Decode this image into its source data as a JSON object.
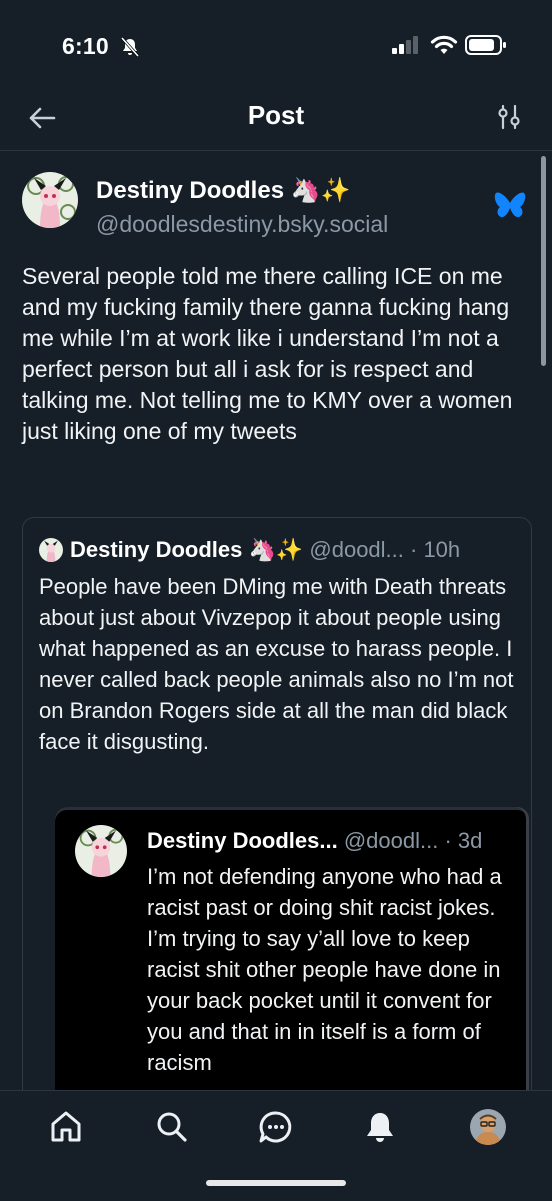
{
  "status_bar": {
    "time": "6:10"
  },
  "nav": {
    "title": "Post"
  },
  "post": {
    "author_name": "Destiny Doodles 🦄✨",
    "handle": "@doodlesdestiny.bsky.social",
    "text": "Several people told me there calling ICE on me and my fucking family there ganna fucking hang me while I’m at work like i understand I’m not a perfect person but all i ask for is respect and talking me. Not telling me to KMY over a women just liking one of my tweets"
  },
  "quote": {
    "author_name": "Destiny Doodles 🦄✨",
    "meta": " @doodl... · 10h",
    "text": "People have been DMing me with Death threats about just about Vivzepop it about people using what happened as an excuse to harass people. I never called back people animals also no I’m not on Brandon Rogers side at all the man did black face it disgusting."
  },
  "nested_quote": {
    "author_name": "Destiny Doodles...",
    "meta": " @doodl... · 3d",
    "text": "I’m not defending anyone who had a racist past or doing shit racist jokes. I’m trying to say y’all love to keep racist shit other people have done in your back pocket until it convent for you and that in in itself is a form of racism"
  },
  "icons": {
    "back": "arrow-left-icon",
    "filter": "sliders-icon",
    "bluesky": "butterfly-icon",
    "tabs": [
      "home-icon",
      "search-icon",
      "chat-icon",
      "bell-icon",
      "profile-avatar"
    ]
  },
  "colors": {
    "background": "#161e27",
    "text": "#f1f3f5",
    "secondary_text": "#8b98a5",
    "bluesky_blue": "#1185fe",
    "nested_background": "#000000"
  }
}
